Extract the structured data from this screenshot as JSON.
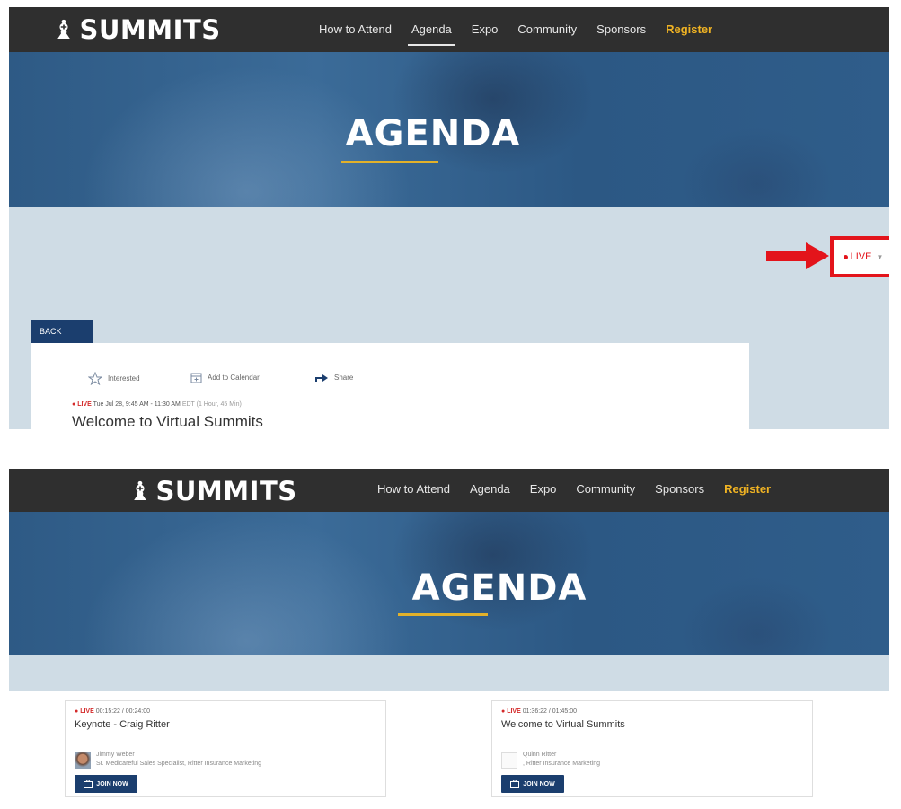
{
  "brand": {
    "logo_text": "SUMMITS",
    "logo_mark_glyph": "♝"
  },
  "nav": {
    "items": [
      "How to Attend",
      "Agenda",
      "Expo",
      "Community",
      "Sponsors"
    ],
    "register": "Register"
  },
  "hero": {
    "title": "AGENDA"
  },
  "colors": {
    "nav_bg": "#2f2f2f",
    "accent_gold": "#f0b323",
    "hero_blue": "#2f5d8a",
    "button_navy": "#1b3e6e",
    "live_red": "#e3141b",
    "page_bg": "#cfdce5"
  },
  "shot1": {
    "live_indicator": "LIVE",
    "back_button": "BACK",
    "actions": {
      "interested": "Interested",
      "add_to_calendar": "Add to Calendar",
      "share": "Share"
    },
    "session": {
      "live": "LIVE",
      "datetime": "Tue Jul 28, 9:45 AM - 11:30 AM",
      "timezone": "EDT",
      "duration": "(1 Hour, 45 Min)",
      "title": "Welcome to Virtual Summits"
    }
  },
  "shot2": {
    "cards": [
      {
        "live": "LIVE",
        "time": "00:15:22 / 00:24:00",
        "title": "Keynote - Craig Ritter",
        "speaker_name": "Jimmy Weber",
        "speaker_role": "Sr. Medicareful Sales Specialist, Ritter Insurance Marketing",
        "join_label": "JOIN NOW"
      },
      {
        "live": "LIVE",
        "time": "01:36:22 / 01:45:00",
        "title": "Welcome to Virtual Summits",
        "speaker_name": "Quinn Ritter",
        "speaker_role": ", Ritter Insurance Marketing",
        "join_label": "JOIN NOW"
      }
    ]
  }
}
